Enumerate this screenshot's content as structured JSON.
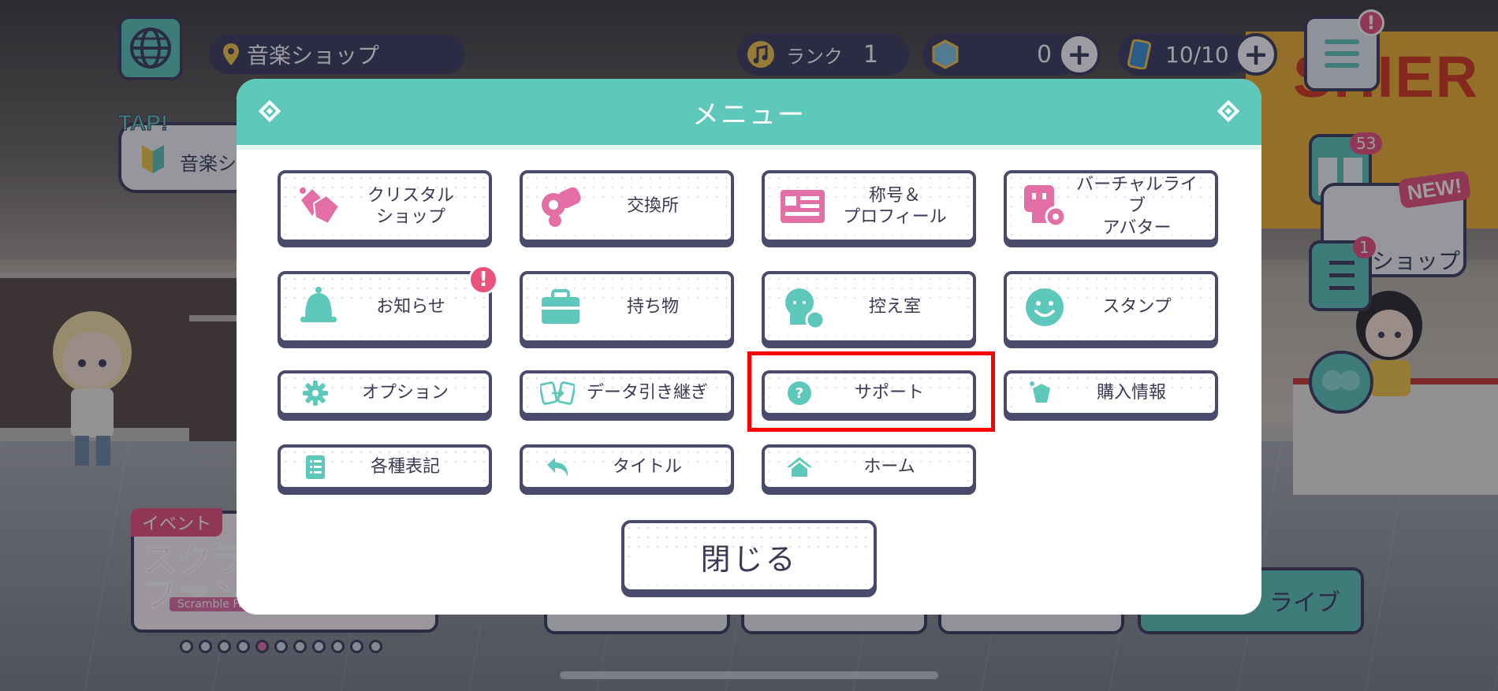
{
  "hud": {
    "location": "音楽ショップ",
    "rank_label": "ランク",
    "rank_value": "1",
    "crystal_value": "0",
    "stamina_value": "10/10",
    "menu_alert": "!",
    "gift_count": "53",
    "mission_count": "1",
    "new_tag": "NEW!",
    "shop_label": "ショップ",
    "tap_label": "TAP!",
    "tap_text": "音楽シ",
    "cashier_sign": "SHIER",
    "live_label": "ライブ"
  },
  "event": {
    "tag": "イベント",
    "title": "スクラン\nファンフ",
    "subtitle": "Scramble Fan"
  },
  "carousel": {
    "total": 11,
    "active_index": 4
  },
  "modal": {
    "title": "メニュー",
    "items": [
      {
        "label": "クリスタル\nショップ",
        "icon": "crystal-shop-icon"
      },
      {
        "label": "交換所",
        "icon": "exchange-icon"
      },
      {
        "label": "称号＆\nプロフィール",
        "icon": "profile-card-icon"
      },
      {
        "label": "バーチャルライブ\nアバター",
        "icon": "avatar-settings-icon"
      },
      {
        "label": "お知らせ",
        "icon": "bell-icon",
        "alert": "!"
      },
      {
        "label": "持ち物",
        "icon": "bag-icon"
      },
      {
        "label": "控え室",
        "icon": "green-room-icon"
      },
      {
        "label": "スタンプ",
        "icon": "smile-icon"
      },
      {
        "label": "オプション",
        "icon": "gear-icon"
      },
      {
        "label": "データ引き継ぎ",
        "icon": "transfer-icon"
      },
      {
        "label": "サポート",
        "icon": "help-icon"
      },
      {
        "label": "購入情報",
        "icon": "purchase-icon"
      },
      {
        "label": "各種表記",
        "icon": "document-icon"
      },
      {
        "label": "タイトル",
        "icon": "back-arrow-icon"
      },
      {
        "label": "ホーム",
        "icon": "home-icon"
      }
    ],
    "close_label": "閉じる"
  },
  "colors": {
    "accent": "#5ec9bb",
    "border": "#4a4a6a",
    "pink": "#e36fa6",
    "highlight": "#ff0000"
  }
}
